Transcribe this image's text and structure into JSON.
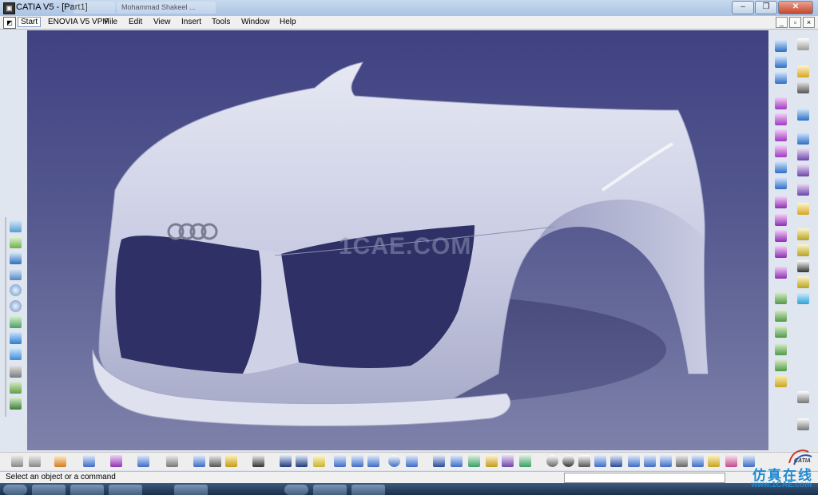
{
  "window": {
    "title": "CATIA V5 - [Part1]",
    "background_tabs": [
      "",
      "Mohammad Shakeel ..."
    ]
  },
  "menu": {
    "items": [
      "Start",
      "ENOVIA V5 VPM",
      "File",
      "Edit",
      "View",
      "Insert",
      "Tools",
      "Window",
      "Help"
    ]
  },
  "viewport": {
    "watermark": "1CAE.COM"
  },
  "status": {
    "message": "Select an object or a command",
    "command_value": ""
  },
  "brand": {
    "cn_text": "仿真在线",
    "url": "www.1CAE.com",
    "catia": "CATIA"
  },
  "colors": {
    "viewport_top": "#3f4182",
    "viewport_bottom": "#7e82aa",
    "model_surface": "#d9dced",
    "brand_blue": "#1f8ad1"
  }
}
